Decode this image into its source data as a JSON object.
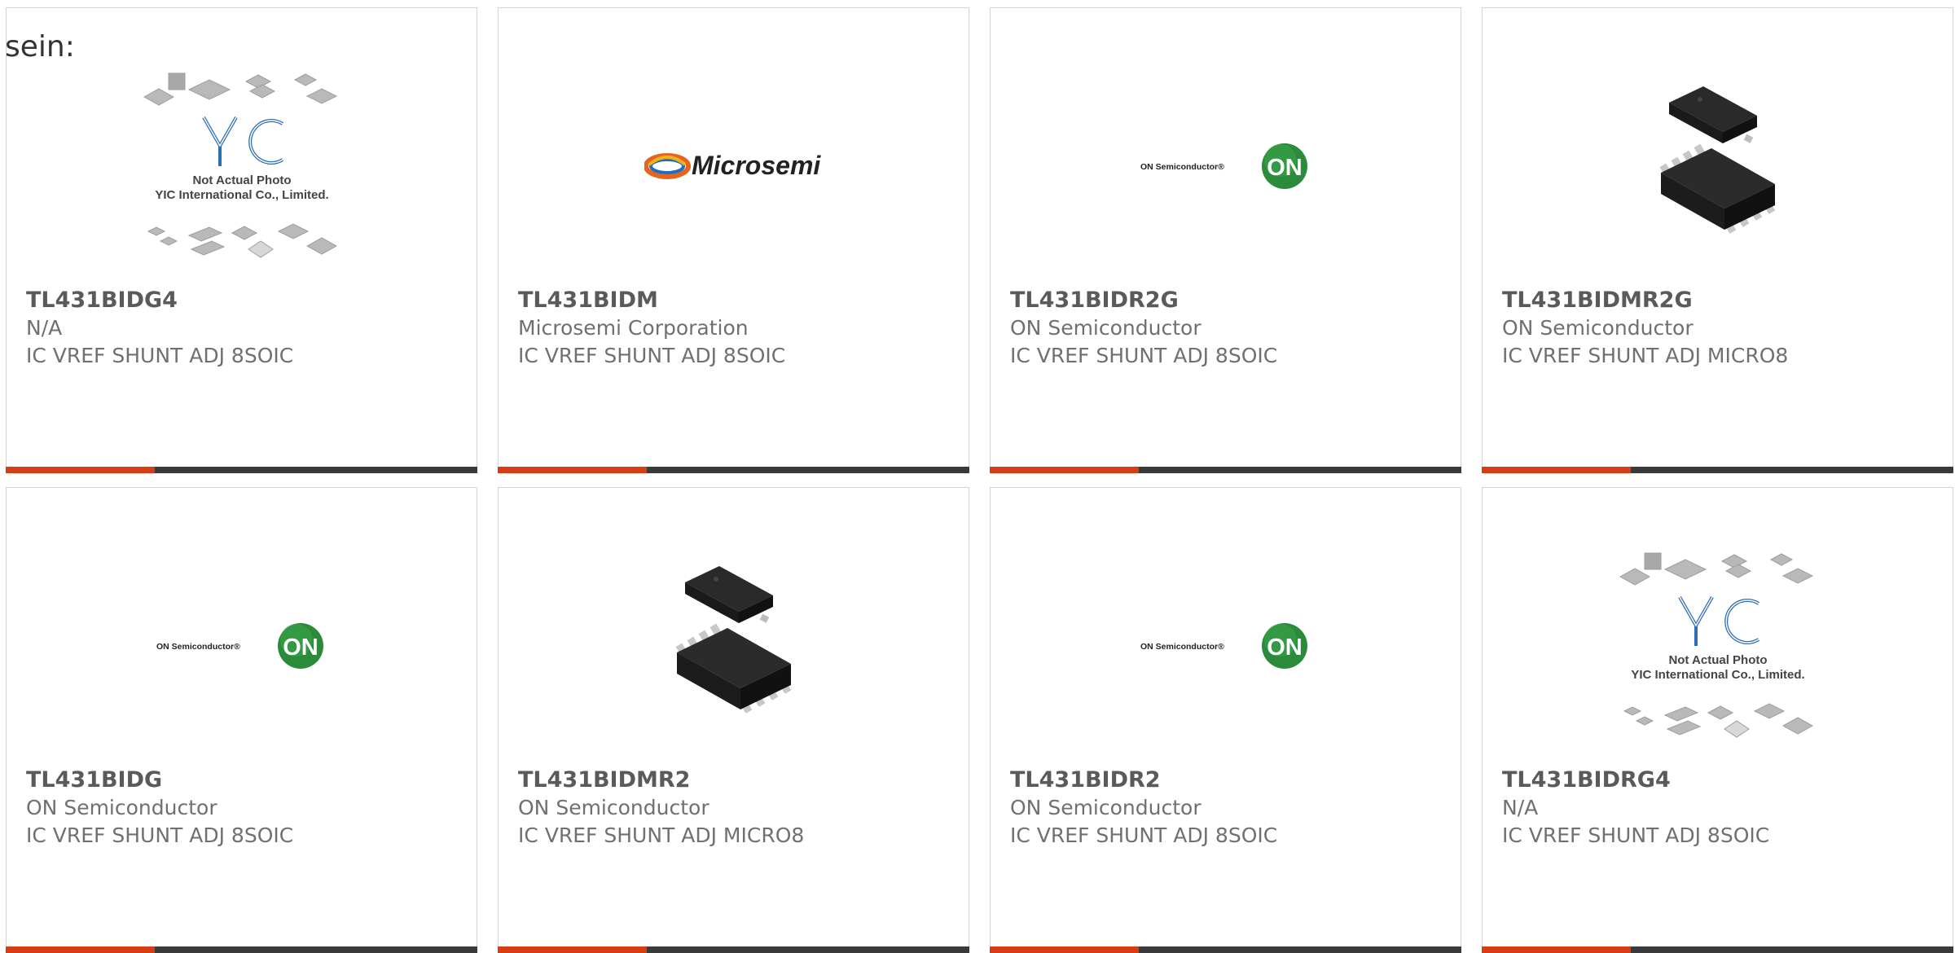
{
  "intro_text": "sein:",
  "accent_color": "#d63d13",
  "products": [
    {
      "part": "TL431BIDG4",
      "manufacturer": "N/A",
      "description": "IC VREF SHUNT ADJ 8SOIC",
      "image": "yic-placeholder",
      "placeholder_line1": "Not Actual Photo",
      "placeholder_line2": "YIC International Co., Limited."
    },
    {
      "part": "TL431BIDM",
      "manufacturer": "Microsemi Corporation",
      "description": "IC VREF SHUNT ADJ 8SOIC",
      "image": "microsemi-logo",
      "logo_text": "Microsemi"
    },
    {
      "part": "TL431BIDR2G",
      "manufacturer": "ON Semiconductor",
      "description": "IC VREF SHUNT ADJ 8SOIC",
      "image": "on-semi-logo",
      "logo_text": "ON Semiconductor®",
      "logo_badge": "ON"
    },
    {
      "part": "TL431BIDMR2G",
      "manufacturer": "ON Semiconductor",
      "description": "IC VREF SHUNT ADJ MICRO8",
      "image": "micro8-chip"
    },
    {
      "part": "TL431BIDG",
      "manufacturer": "ON Semiconductor",
      "description": "IC VREF SHUNT ADJ 8SOIC",
      "image": "on-semi-logo",
      "logo_text": "ON Semiconductor®",
      "logo_badge": "ON"
    },
    {
      "part": "TL431BIDMR2",
      "manufacturer": "ON Semiconductor",
      "description": "IC VREF SHUNT ADJ MICRO8",
      "image": "micro8-chip"
    },
    {
      "part": "TL431BIDR2",
      "manufacturer": "ON Semiconductor",
      "description": "IC VREF SHUNT ADJ 8SOIC",
      "image": "on-semi-logo",
      "logo_text": "ON Semiconductor®",
      "logo_badge": "ON"
    },
    {
      "part": "TL431BIDRG4",
      "manufacturer": "N/A",
      "description": "IC VREF SHUNT ADJ 8SOIC",
      "image": "yic-placeholder",
      "placeholder_line1": "Not Actual Photo",
      "placeholder_line2": "YIC International Co., Limited."
    }
  ]
}
